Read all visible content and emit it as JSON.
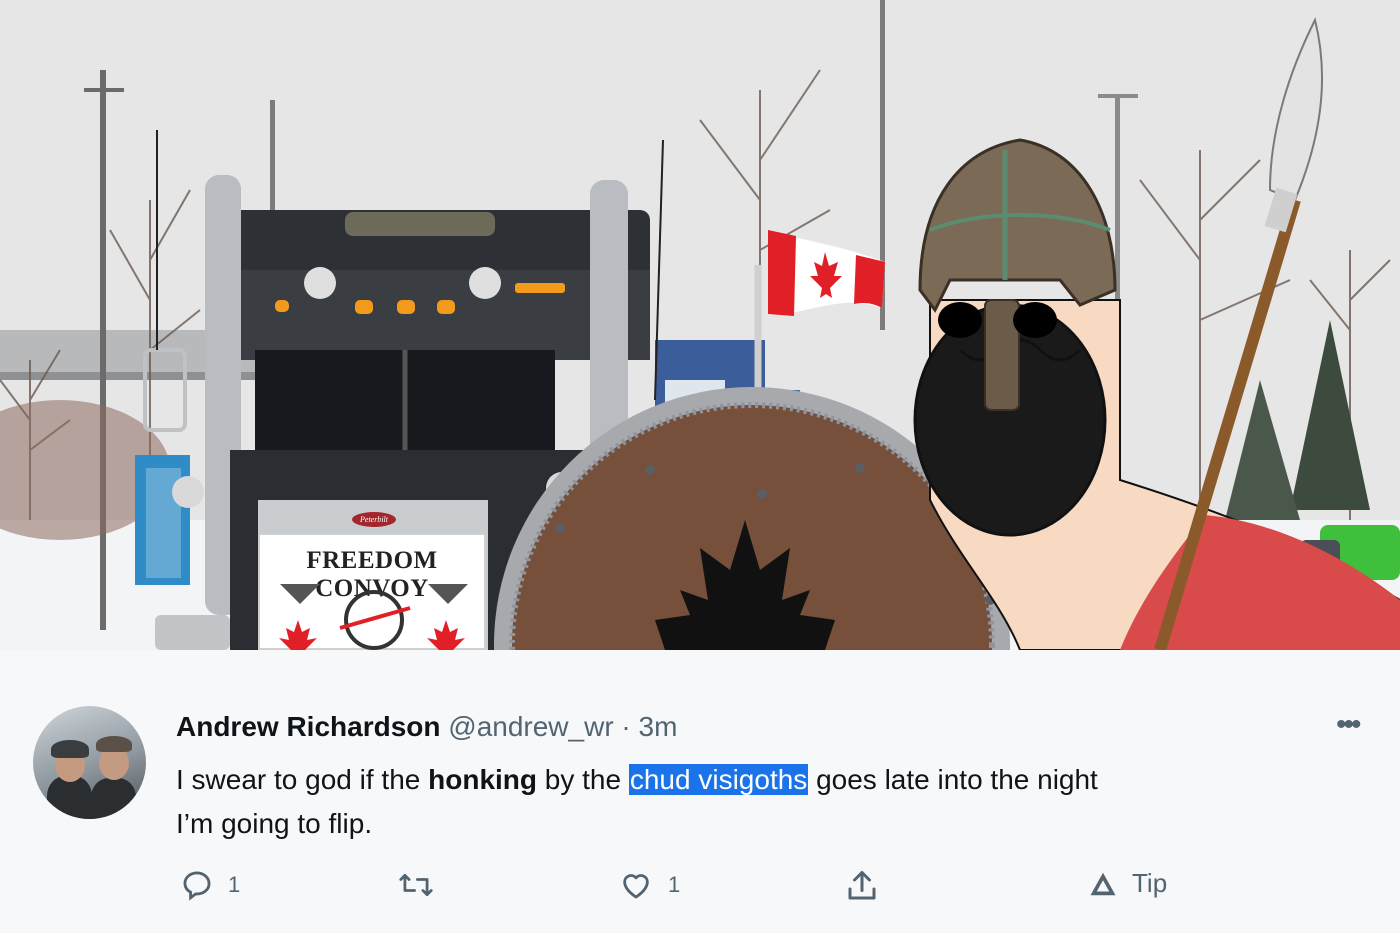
{
  "image": {
    "truck_sign_text": "FREEDOM CONVOY",
    "truck_brand_text": "Peterbilt"
  },
  "tweet": {
    "author_name": "Andrew Richardson",
    "author_handle": "@andrew_wr",
    "separator": "·",
    "time": "3m",
    "more_icon": "•••",
    "text_parts": {
      "p1": "I swear to god if the ",
      "p2": "honking",
      "p3": " by the ",
      "p4": "chud visigoths",
      "p5": " goes late into the night",
      "p6": "I’m going to flip."
    },
    "actions": {
      "reply_icon": "reply-icon",
      "reply_count": "1",
      "retweet_icon": "retweet-icon",
      "like_icon": "heart-icon",
      "like_count": "1",
      "share_icon": "share-icon",
      "tip_icon": "tip-icon",
      "tip_label": "Tip"
    },
    "highlight_color": "#1a73e8"
  }
}
